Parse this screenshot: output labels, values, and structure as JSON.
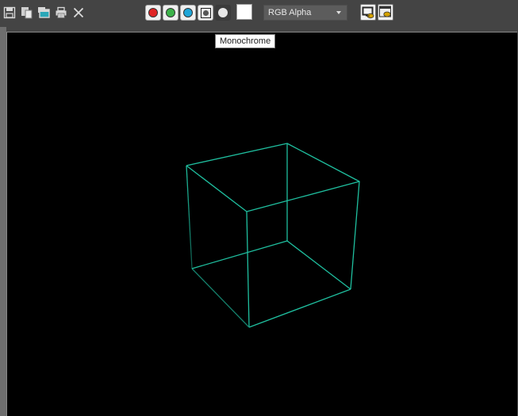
{
  "toolbar": {
    "icons": [
      {
        "name": "save-icon"
      },
      {
        "name": "copy-icon"
      },
      {
        "name": "clone-window-icon"
      },
      {
        "name": "print-icon"
      },
      {
        "name": "close-icon"
      }
    ],
    "channels": [
      {
        "name": "red-channel",
        "color": "#e02424"
      },
      {
        "name": "green-channel",
        "color": "#3cb34a"
      },
      {
        "name": "blue-channel",
        "color": "#1fa6d8"
      },
      {
        "name": "alpha-channel",
        "color": "#555555"
      },
      {
        "name": "monochrome",
        "color": "#e6e6e6"
      }
    ],
    "swatch_color": "#ffffff",
    "channel_select": {
      "selected": "RGB Alpha"
    }
  },
  "tooltip": {
    "text": "Monochrome"
  },
  "viewport": {
    "background": "#000000",
    "wire_color": "#1fbf9f"
  }
}
